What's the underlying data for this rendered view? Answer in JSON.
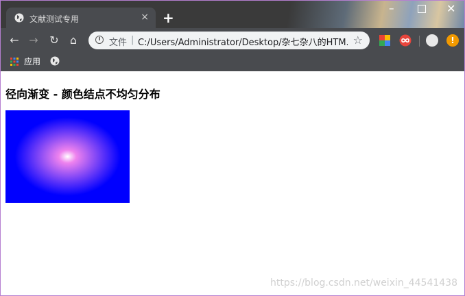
{
  "browser": {
    "tab": {
      "title": "文献测试专用",
      "close": "×"
    },
    "new_tab": "+",
    "window": {
      "minimize": "–",
      "close": "✕"
    },
    "toolbar": {
      "back": "←",
      "forward": "→",
      "reload": "↻",
      "home": "⌂",
      "file_label": "文件",
      "separator": "|",
      "url": "C:/Users/Administrator/Desktop/杂七杂八的HTM...",
      "star": "☆"
    },
    "bookmarks": {
      "apps_label": "应用"
    },
    "alert": "!"
  },
  "page": {
    "heading": "径向渐变 - 颜色结点不均匀分布",
    "gradient": {
      "inner": "#ffffff",
      "middle": "#ee82ee",
      "outer": "#0000ff"
    }
  },
  "watermark": "https://blog.csdn.net/weixin_44541438"
}
